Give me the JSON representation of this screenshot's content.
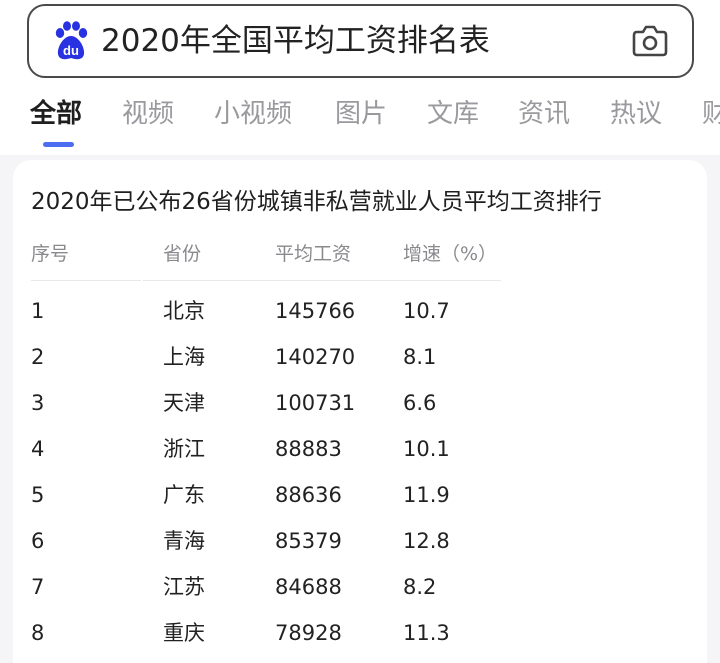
{
  "search": {
    "query": "2020年全国平均工资排名表",
    "logo_text": "du"
  },
  "tabs": [
    {
      "label": "全部",
      "active": true
    },
    {
      "label": "视频",
      "active": false
    },
    {
      "label": "小视频",
      "active": false
    },
    {
      "label": "图片",
      "active": false
    },
    {
      "label": "文库",
      "active": false
    },
    {
      "label": "资讯",
      "active": false
    },
    {
      "label": "热议",
      "active": false
    },
    {
      "label": "财",
      "active": false
    }
  ],
  "colors": {
    "accent": "#4e6ef2",
    "logo": "#2932e1"
  },
  "table": {
    "title": "2020年已公布26省份城镇非私营就业人员平均工资排行",
    "headers": [
      "序号",
      "省份",
      "平均工资",
      "增速（%）"
    ],
    "rows": [
      [
        "1",
        "北京",
        "145766",
        "10.7"
      ],
      [
        "2",
        "上海",
        "140270",
        "8.1"
      ],
      [
        "3",
        "天津",
        "100731",
        "6.6"
      ],
      [
        "4",
        "浙江",
        "88883",
        "10.1"
      ],
      [
        "5",
        "广东",
        "88636",
        "11.9"
      ],
      [
        "6",
        "青海",
        "85379",
        "12.8"
      ],
      [
        "7",
        "江苏",
        "84688",
        "8.2"
      ],
      [
        "8",
        "重庆",
        "78928",
        "11.3"
      ]
    ]
  },
  "icons": {
    "logo": "baidu-paw-icon",
    "camera": "camera-icon"
  }
}
